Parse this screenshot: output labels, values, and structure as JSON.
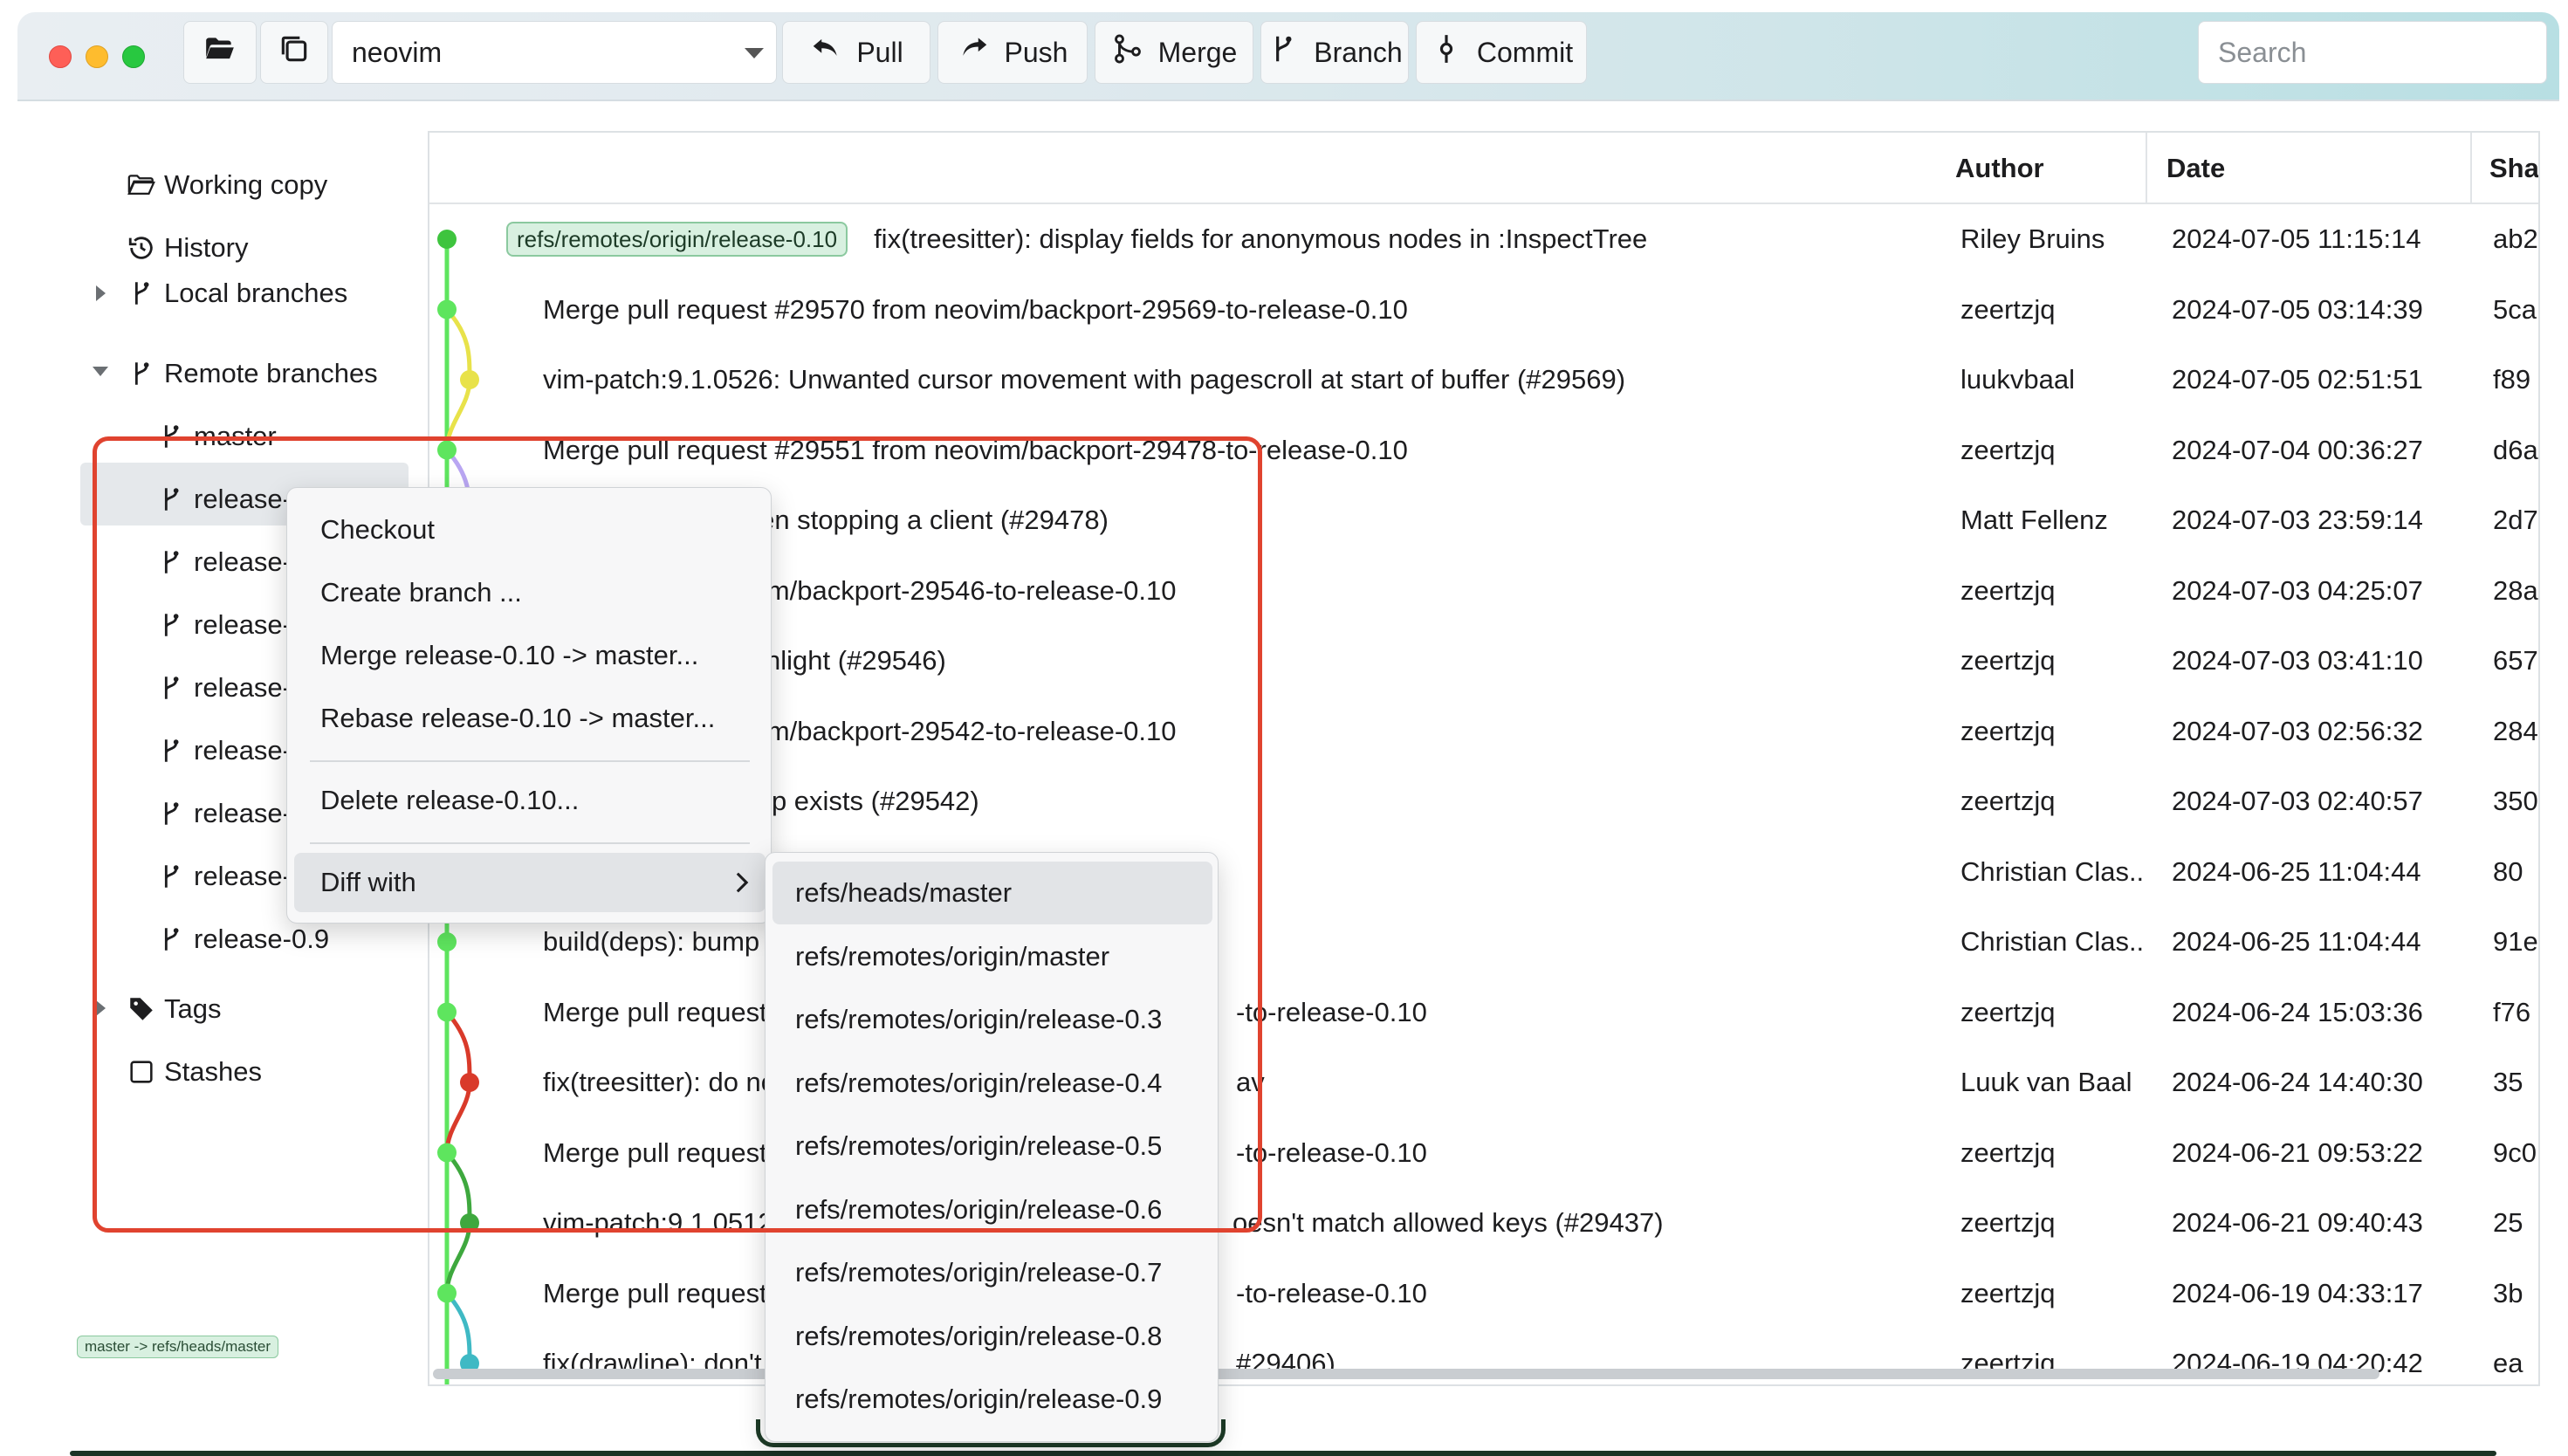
{
  "toolbar": {
    "repo": "neovim",
    "buttons": {
      "pull": "Pull",
      "push": "Push",
      "merge": "Merge",
      "branch": "Branch",
      "commit": "Commit"
    },
    "search_placeholder": "Search"
  },
  "sidebar": {
    "working_copy": "Working copy",
    "history": "History",
    "local_branches": "Local branches",
    "remote_branches": "Remote branches",
    "remote_items": [
      "master",
      "release-0.10",
      "release-0.",
      "release-0.",
      "release-0.",
      "release-0.",
      "release-0.",
      "release-0.",
      "release-0.9"
    ],
    "tags": "Tags",
    "stashes": "Stashes",
    "bottom_badge": "master -> refs/heads/master"
  },
  "log": {
    "columns": {
      "author": "Author",
      "date": "Date",
      "sha": "Sha"
    },
    "rows": [
      {
        "ref": "refs/remotes/origin/release-0.10",
        "message": "fix(treesitter): display fields for anonymous nodes in :InspectTree",
        "author": "Riley Bruins",
        "date": "2024-07-05 11:15:14",
        "sha": "ab2"
      },
      {
        "message": "Merge pull request #29570 from neovim/backport-29569-to-release-0.10",
        "author": "zeertzjq",
        "date": "2024-07-05 03:14:39",
        "sha": "5ca"
      },
      {
        "message": "vim-patch:9.1.0526: Unwanted cursor movement with pagescroll at start of buffer (#29569)",
        "author": "luukvbaal",
        "date": "2024-07-05 02:51:51",
        "sha": "f89"
      },
      {
        "message": "Merge pull request #29551 from neovim/backport-29478-to-release-0.10",
        "author": "zeertzjq",
        "date": "2024-07-04 00:36:27",
        "sha": "d6a"
      },
      {
        "message": "ymap.del error when stopping a client (#29478)",
        "author": "Matt Fellenz",
        "date": "2024-07-03 23:59:14",
        "sha": "2d7"
      },
      {
        "message": "#29547 from neovim/backport-29546-to-release-0.10",
        "author": "zeertzjq",
        "date": "2024-07-03 04:25:07",
        "sha": "28a"
      },
      {
        "message": "pping treesitter highlight (#29546)",
        "author": "zeertzjq",
        "date": "2024-07-03 03:41:10",
        "sha": "657"
      },
      {
        "message": "#29545 from neovim/backport-29542-to-release-0.10",
        "author": "zeertzjq",
        "date": "2024-07-03 02:56:32",
        "sha": "284"
      },
      {
        "message": "e syntaxset augroup exists (#29542)",
        "author": "zeertzjq",
        "date": "2024-07-03 02:40:57",
        "sha": "350"
      },
      {
        "message": "",
        "author": "Christian Clas...",
        "date": "2024-06-25 11:04:44",
        "sha": "80"
      },
      {
        "message": "build(deps): bump tre",
        "author": "Christian Clas...",
        "date": "2024-06-25 11:04:44",
        "sha": "91e"
      },
      {
        "message": "Merge pull request",
        "tail": "-to-release-0.10",
        "author": "zeertzjq",
        "date": "2024-06-24 15:03:36",
        "sha": "f76"
      },
      {
        "message": "fix(treesitter): do no",
        "tail": "av",
        "author": "Luuk van Baal",
        "date": "2024-06-24 14:40:30",
        "sha": "35"
      },
      {
        "message": "Merge pull request",
        "tail": "-to-release-0.10",
        "author": "zeertzjq",
        "date": "2024-06-21 09:53:22",
        "sha": "9c0"
      },
      {
        "message": "vim-patch:9.1.0512",
        "tail": "oesn't match allowed keys (#29437)",
        "author": "zeertzjq",
        "date": "2024-06-21 09:40:43",
        "sha": "25"
      },
      {
        "message": "Merge pull request",
        "tail": "-to-release-0.10",
        "author": "zeertzjq",
        "date": "2024-06-19 04:33:17",
        "sha": "3b"
      },
      {
        "message": "fix(drawline): don't",
        "tail": "#29406)",
        "author": "zeertzjq",
        "date": "2024-06-19 04:20:42",
        "sha": "ea"
      }
    ]
  },
  "context_menu": {
    "items": [
      "Checkout",
      "Create branch ...",
      "Merge release-0.10 -> master...",
      "Rebase release-0.10 -> master...",
      "Delete release-0.10...",
      "Diff with"
    ]
  },
  "diff_submenu": {
    "items": [
      "refs/heads/master",
      "refs/remotes/origin/master",
      "refs/remotes/origin/release-0.3",
      "refs/remotes/origin/release-0.4",
      "refs/remotes/origin/release-0.5",
      "refs/remotes/origin/release-0.6",
      "refs/remotes/origin/release-0.7",
      "refs/remotes/origin/release-0.8",
      "refs/remotes/origin/release-0.9"
    ]
  },
  "colors": {
    "graph_green": "#5ee55e",
    "graph_yellow": "#e8e24a",
    "graph_purple": "#b9a6f2",
    "graph_red": "#d93a2a",
    "graph_teal": "#3fb9c4",
    "highlight": "#e0432f"
  }
}
